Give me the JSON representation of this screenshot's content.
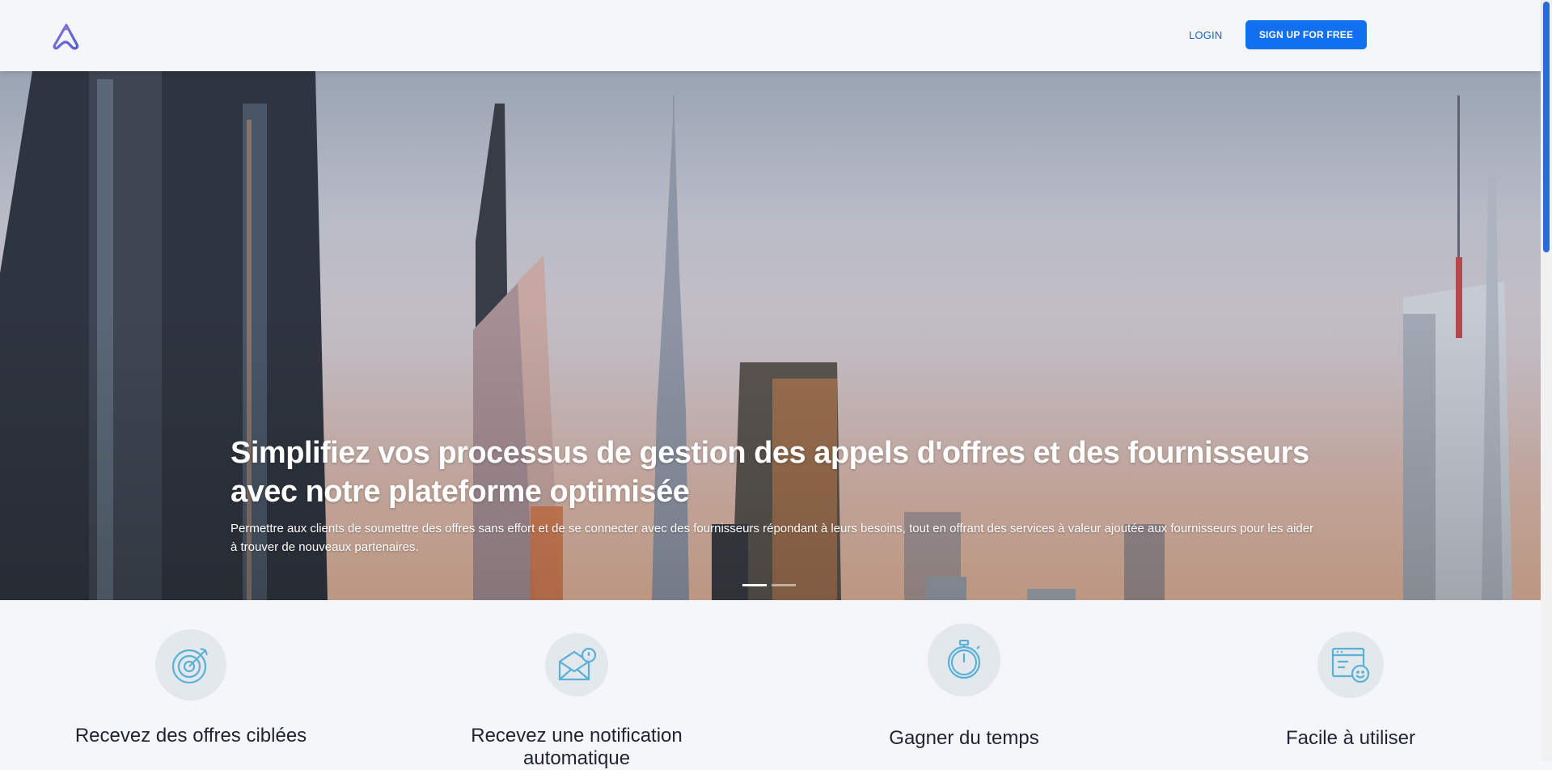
{
  "header": {
    "logo_icon": "brand-logo-icon",
    "login_label": "LOGIN",
    "signup_label": "SIGN UP FOR FREE"
  },
  "hero": {
    "title": "Simplifiez vos processus de gestion des appels d'offres et des fournisseurs avec notre plateforme optimisée",
    "description": "Permettre aux clients de soumettre des offres sans effort et de se connecter avec des fournisseurs répondant à leurs besoins, tout en offrant des services à valeur ajoutée aux fournisseurs pour les aider à trouver de nouveaux partenaires.",
    "slides": 2,
    "active_slide": 1
  },
  "features": [
    {
      "icon": "target-icon",
      "title": "Recevez des offres ciblées"
    },
    {
      "icon": "mail-notification-icon",
      "title": "Recevez une notification automatique"
    },
    {
      "icon": "stopwatch-icon",
      "title": "Gagner du temps"
    },
    {
      "icon": "easy-to-use-icon",
      "title": "Facile à utiliser"
    }
  ],
  "colors": {
    "primary": "#1070f0",
    "link": "#1565d8",
    "icon": "#5ab0d6",
    "icon_bg": "#e3e8ec",
    "text_dark": "#1f2433"
  }
}
